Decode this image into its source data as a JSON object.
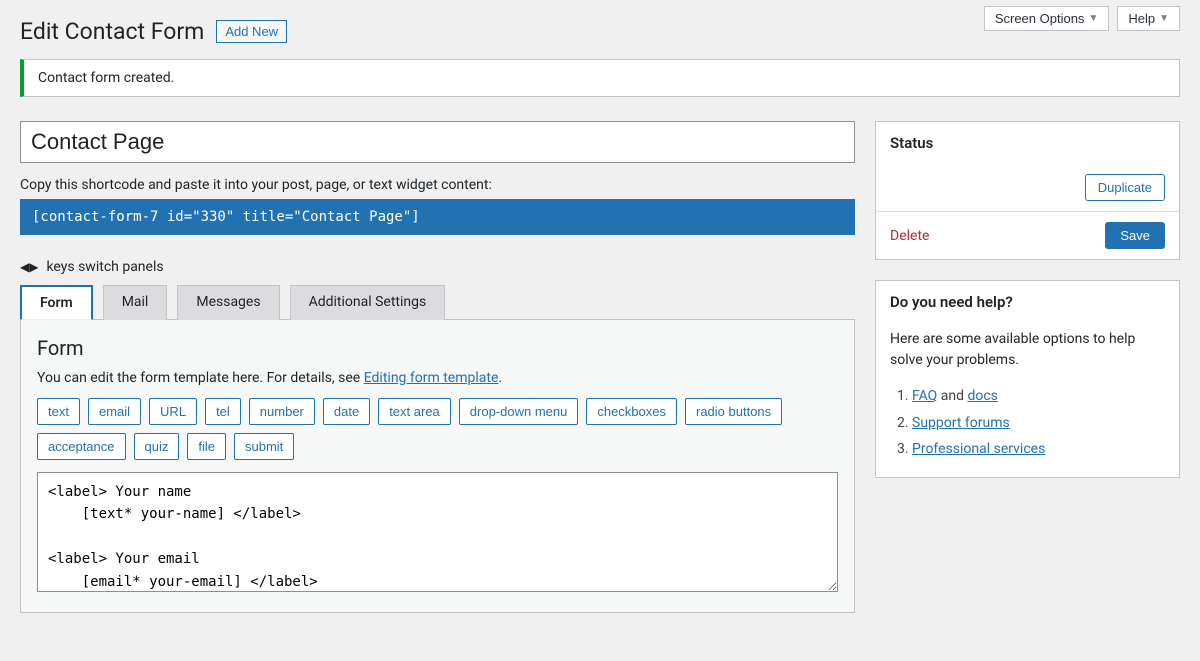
{
  "topButtons": {
    "screenOptions": "Screen Options",
    "help": "Help"
  },
  "pageTitle": "Edit Contact Form",
  "addNew": "Add New",
  "notice": "Contact form created.",
  "formTitle": "Contact Page",
  "shortcodeLabel": "Copy this shortcode and paste it into your post, page, or text widget content:",
  "shortcode": "[contact-form-7 id=\"330\" title=\"Contact Page\"]",
  "keysHint": "keys switch panels",
  "tabs": {
    "form": "Form",
    "mail": "Mail",
    "messages": "Messages",
    "additional": "Additional Settings"
  },
  "formPanel": {
    "heading": "Form",
    "descPrefix": "You can edit the form template here. For details, see ",
    "descLink": "Editing form template",
    "descSuffix": ".",
    "tagButtons": [
      "text",
      "email",
      "URL",
      "tel",
      "number",
      "date",
      "text area",
      "drop-down menu",
      "checkboxes",
      "radio buttons",
      "acceptance",
      "quiz",
      "file",
      "submit"
    ],
    "textarea": "<label> Your name\n    [text* your-name] </label>\n\n<label> Your email\n    [email* your-email] </label>"
  },
  "statusBox": {
    "heading": "Status",
    "duplicate": "Duplicate",
    "delete": "Delete",
    "save": "Save"
  },
  "helpBox": {
    "heading": "Do you need help?",
    "intro": "Here are some available options to help solve your problems.",
    "items": [
      {
        "prefix": "",
        "link": "FAQ",
        "mid": " and ",
        "link2": "docs",
        "suffix": ""
      },
      {
        "prefix": "",
        "link": "Support forums",
        "mid": "",
        "link2": "",
        "suffix": ""
      },
      {
        "prefix": "",
        "link": "Professional services",
        "mid": "",
        "link2": "",
        "suffix": ""
      }
    ]
  }
}
